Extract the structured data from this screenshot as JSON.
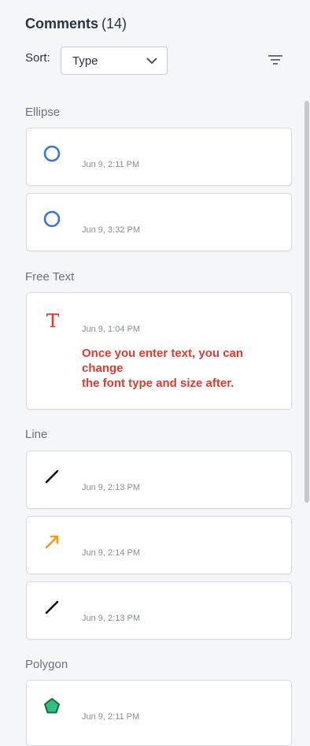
{
  "header": {
    "title": "Comments",
    "count": "(14)"
  },
  "sort": {
    "label": "Sort:",
    "value": "Type"
  },
  "sections": {
    "ellipse": {
      "title": "Ellipse"
    },
    "free_text": {
      "title": "Free Text"
    },
    "line": {
      "title": "Line"
    },
    "polygon": {
      "title": "Polygon"
    }
  },
  "comments": [
    {
      "icon": "ellipse-icon",
      "time": "Jun 9, 2:11 PM"
    },
    {
      "icon": "ellipse-icon",
      "time": "Jun 9, 3:32 PM"
    },
    {
      "icon": "free-text-icon",
      "time": "Jun 9, 1:04 PM",
      "text": "Once you enter text, you can\nchange\nthe font type and size after."
    },
    {
      "icon": "line-icon",
      "time": "Jun 9, 2:13 PM"
    },
    {
      "icon": "arrow-icon",
      "time": "Jun 9, 2:14 PM"
    },
    {
      "icon": "line-icon",
      "time": "Jun 9, 2:13 PM"
    },
    {
      "icon": "polygon-icon",
      "time": "Jun 9, 2:11 PM"
    }
  ],
  "colors": {
    "ellipse": "#3a72e8",
    "free_text": "#e03b2f",
    "line": "#111111",
    "arrow": "#f39a1d",
    "polygon": "#1e9b62"
  }
}
